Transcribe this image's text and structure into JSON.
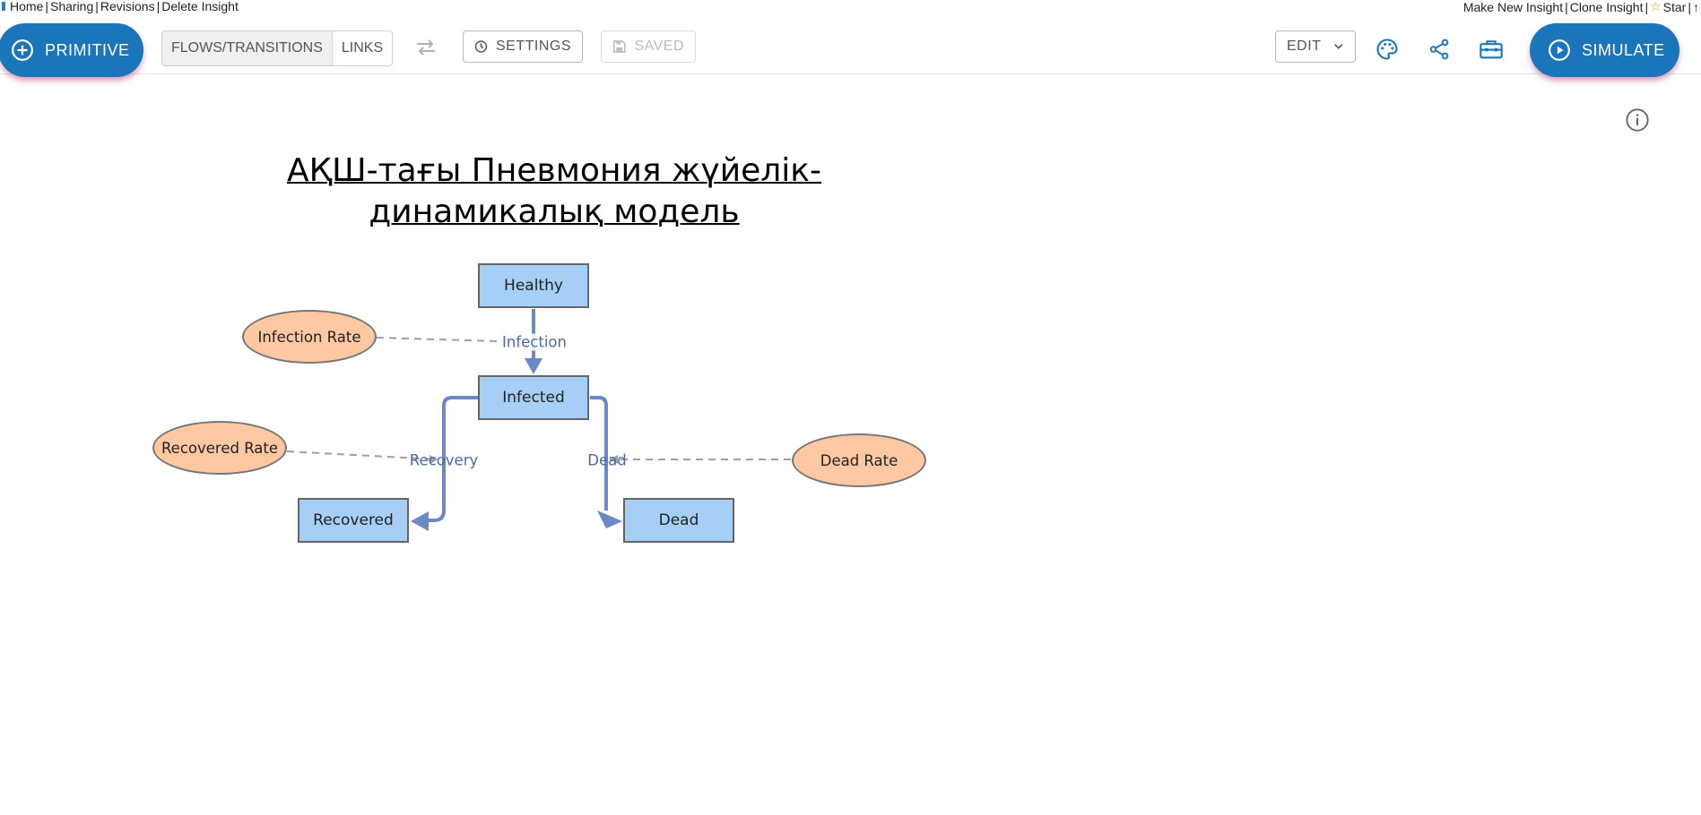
{
  "nav": {
    "left": [
      "Home",
      "Sharing",
      "Revisions",
      "Delete Insight"
    ],
    "right": [
      "Make New Insight",
      "Clone Insight"
    ],
    "star": "Star",
    "arrow": "↑"
  },
  "toolbar": {
    "primitive": "PRIMITIVE",
    "flows": "FLOWS/TRANSITIONS",
    "links": "LINKS",
    "settings": "SETTINGS",
    "saved": "SAVED",
    "edit": "EDIT",
    "simulate": "SIMULATE"
  },
  "colors": {
    "accent": "#1b75bb",
    "stock_fill": "#a6cff5",
    "variable_fill": "#fec8a3",
    "flow": "#6a89c6"
  },
  "icons": [
    "plus-circle-icon",
    "swap-icon",
    "clock-icon",
    "save-icon",
    "chevron-down-icon",
    "palette-icon",
    "share-icon",
    "toolbox-icon",
    "play-circle-icon",
    "info-icon"
  ],
  "model": {
    "title_line1": "АҚШ-тағы Пневмония жүйелік-",
    "title_line2": "динамикалық модель",
    "stocks": {
      "healthy": "Healthy",
      "infected": "Infected",
      "recovered": "Recovered",
      "dead": "Dead"
    },
    "variables": {
      "infection_rate": "Infection Rate",
      "recovered_rate": "Recovered Rate",
      "dead_rate": "Dead Rate"
    },
    "flows": {
      "infection": "Infection",
      "recovery": "Recovery",
      "dead": "Dead"
    }
  }
}
